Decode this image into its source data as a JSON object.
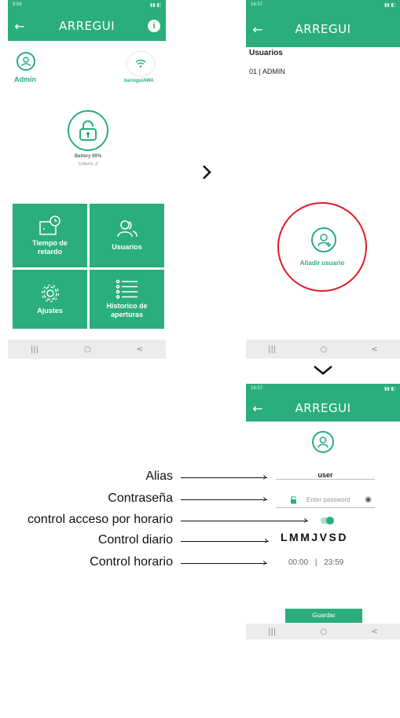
{
  "app": {
    "title": "ARREGUI"
  },
  "screen1": {
    "status_time": "9:58",
    "user_name": "Admin",
    "wifi_name": "barreguiAWA",
    "battery": "Battery 99%",
    "device_id": "Coffer01_0",
    "tiles": {
      "delay": "Tiempo de retardo",
      "users": "Usuarios",
      "settings": "Ajustes",
      "history": "Historico de aperturas"
    }
  },
  "screen2": {
    "status_time": "16:57",
    "heading": "Usuarios",
    "user_entry": "01 | ADMIN",
    "add_user": "Añadir usuario"
  },
  "screen3": {
    "status_time": "16:57",
    "alias_value": "user",
    "password_placeholder": "Enter password",
    "days": "LMMJVSD",
    "time_from": "00:00",
    "time_sep": "|",
    "time_to": "23:59",
    "save_button": "Guardar"
  },
  "annotations": {
    "alias": "Alias",
    "password": "Contraseña",
    "schedule_access": "control acceso por horario",
    "daily": "Control diario",
    "hourly": "Control horario"
  },
  "navbar": {
    "recent": "|||",
    "home": "○",
    "back": "<"
  },
  "colors": {
    "brand_green": "#2aae7b",
    "highlight_red": "#e01b24"
  }
}
